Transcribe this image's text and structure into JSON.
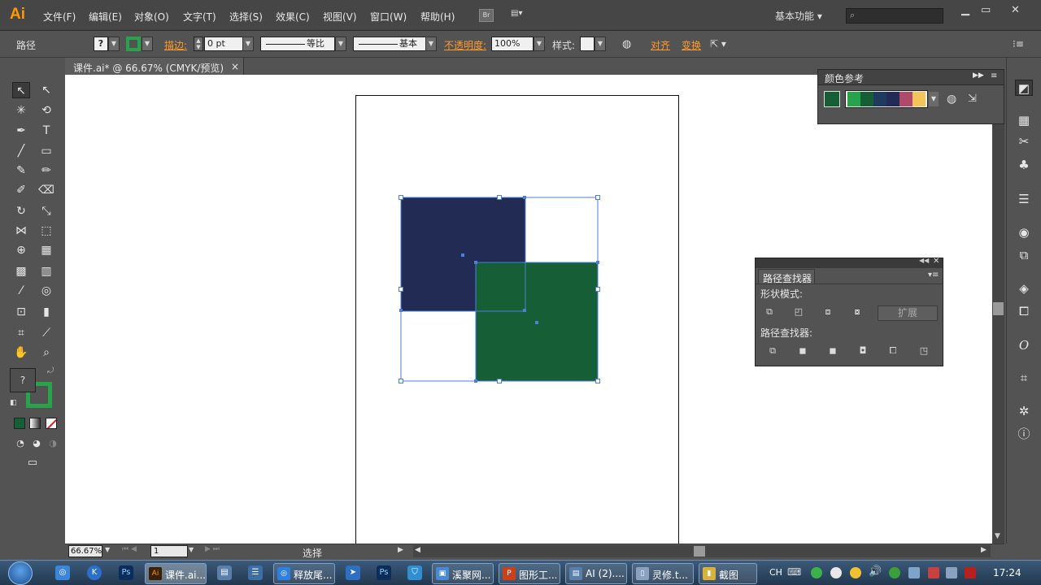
{
  "app": {
    "logo": "Ai"
  },
  "menu": [
    "文件(F)",
    "编辑(E)",
    "对象(O)",
    "文字(T)",
    "选择(S)",
    "效果(C)",
    "视图(V)",
    "窗口(W)",
    "帮助(H)"
  ],
  "menubar": {
    "bridge": "Br",
    "workspace": "基本功能 ▾",
    "search_placeholder": "",
    "search_icon": "⌕"
  },
  "controlbar": {
    "selection_type": "路径",
    "stroke_label": "描边:",
    "stroke_weight": "0 pt",
    "profile_label": "等比",
    "brush_label": "基本",
    "opacity_label": "不透明度:",
    "opacity_value": "100%",
    "style_label": "样式:",
    "align_label": "对齐",
    "transform_label": "变换"
  },
  "document": {
    "tab_title": "课件.ai* @ 66.67% (CMYK/预览)",
    "close": "×"
  },
  "toolbar": {
    "fill_value": "?",
    "stroke_color": "#27a34a"
  },
  "colors": {
    "navy": "#222b54",
    "dark_green": "#165e36",
    "selection_blue": "#4d7fd8",
    "accent_orange": "#ff9a2e"
  },
  "color_guide": {
    "title": "颜色参考",
    "base_color": "#165e36",
    "swatches": [
      "#27a34a",
      "#165e36",
      "#1e3a5f",
      "#222b54",
      "#b0496b",
      "#d46a6a",
      "#f2c45a"
    ]
  },
  "pathfinder": {
    "title": "路径查找器",
    "shape_modes_label": "形状模式:",
    "pathfinders_label": "路径查找器:",
    "expand_label": "扩展"
  },
  "statusbar": {
    "zoom": "66.67%",
    "page": "1",
    "status": "选择"
  },
  "taskbar": {
    "tasks": [
      "课件.ai...",
      "释放尾...",
      "溪聚网...",
      "图形工...",
      "AI (2)....",
      "灵修.t...",
      "截图"
    ],
    "ime": "CH",
    "time": "17:24"
  }
}
